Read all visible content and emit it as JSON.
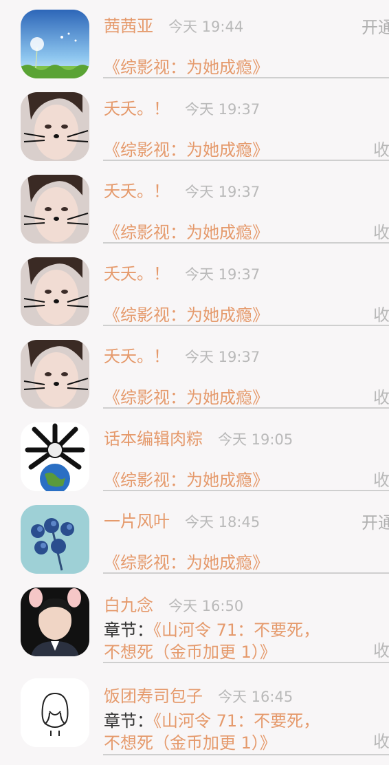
{
  "items": [
    {
      "name": "茜茜亚",
      "time": "今天 19:44",
      "book": "《综影视：为她成瘾》",
      "action": "开通"
    },
    {
      "name": "夭夭。！",
      "time": "今天 19:37",
      "book": "《综影视：为她成瘾》",
      "action": "收"
    },
    {
      "name": "夭夭。！",
      "time": "今天 19:37",
      "book": "《综影视：为她成瘾》",
      "action": "收"
    },
    {
      "name": "夭夭。！",
      "time": "今天 19:37",
      "book": "《综影视：为她成瘾》",
      "action": "收"
    },
    {
      "name": "夭夭。！",
      "time": "今天 19:37",
      "book": "《综影视：为她成瘾》",
      "action": "收"
    },
    {
      "name": "话本编辑肉粽",
      "time": "今天 19:05",
      "book": "《综影视：为她成瘾》",
      "action": "收"
    },
    {
      "name": "一片风叶",
      "time": "今天 18:45",
      "book": "《综影视：为她成瘾》",
      "action": "开通"
    },
    {
      "name": "白九念",
      "time": "今天 16:50",
      "chapter_label": "章节：",
      "chapter_line1": "《山河令 71：不要死，",
      "chapter_line2": "不想死（金币加更 1）》",
      "action": "收"
    },
    {
      "name": "饭团寿司包子",
      "time": "今天 16:45",
      "chapter_label": "章节：",
      "chapter_line1": "《山河令 71：不要死，",
      "chapter_line2": "不想死（金币加更 1）》",
      "action": "收"
    }
  ],
  "avatars": [
    "dandelion-avatar",
    "girl-cat-filter-avatar",
    "girl-cat-filter-avatar",
    "girl-cat-filter-avatar",
    "girl-cat-filter-avatar",
    "earth-meme-avatar",
    "blue-flowers-avatar",
    "man-bunny-ears-avatar",
    "line-drawing-woman-avatar"
  ],
  "colors": {
    "accent": "#e59a6c",
    "muted": "#b9b9b9",
    "background": "#f8f6f7",
    "divider": "#cfcfcf"
  }
}
